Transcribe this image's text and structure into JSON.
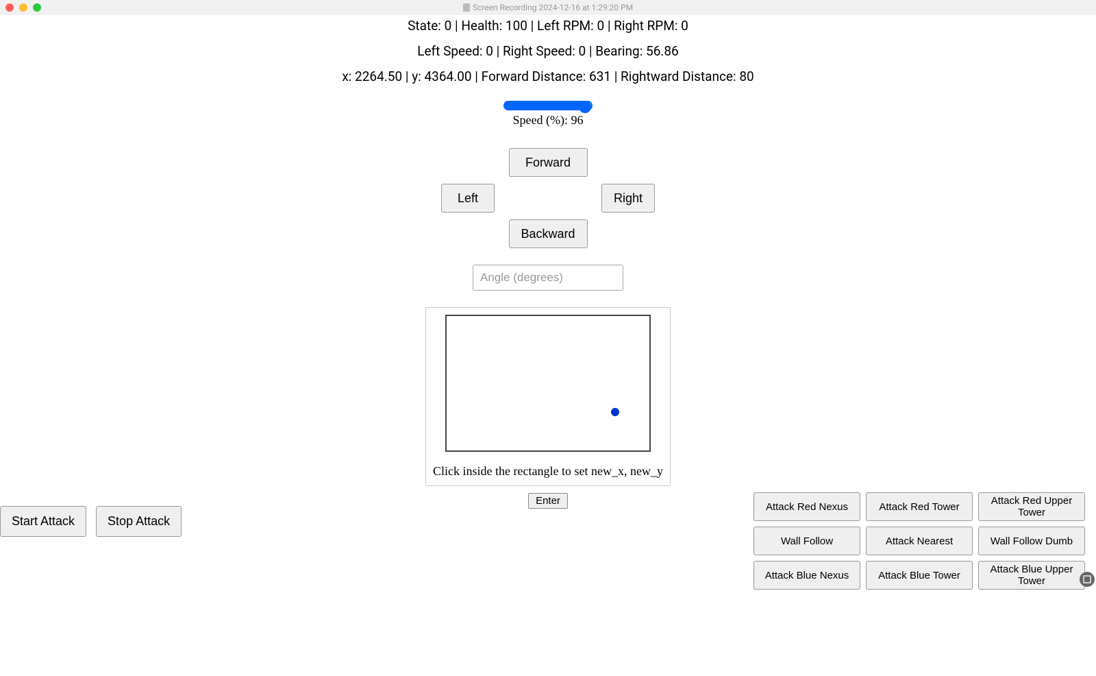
{
  "titlebar": {
    "title": "Screen Recording 2024-12-16 at 1:29:20 PM"
  },
  "status": {
    "line1": "State: 0 | Health: 100 | Left RPM: 0 | Right RPM: 0",
    "line2": "Left Speed: 0 | Right Speed: 0 | Bearing: 56.86",
    "line3": "x: 2264.50 | y: 4364.00 | Forward Distance: 631 | Rightward Distance: 80"
  },
  "speed_slider": {
    "label": "Speed (%): 96",
    "value": 96
  },
  "dpad": {
    "forward": "Forward",
    "backward": "Backward",
    "left": "Left",
    "right": "Right"
  },
  "angle_input": {
    "placeholder": "Angle (degrees)",
    "value": ""
  },
  "map": {
    "caption": "Click inside the rectangle to set new_x, new_y",
    "dot_color": "#0033cc"
  },
  "enter_btn": "Enter",
  "attack_controls": {
    "start": "Start Attack",
    "stop": "Stop Attack"
  },
  "action_grid": [
    [
      "Attack Red Nexus",
      "Attack Red Tower",
      "Attack Red Upper Tower"
    ],
    [
      "Wall Follow",
      "Attack Nearest",
      "Wall Follow Dumb"
    ],
    [
      "Attack Blue Nexus",
      "Attack Blue Tower",
      "Attack Blue Upper Tower"
    ]
  ]
}
